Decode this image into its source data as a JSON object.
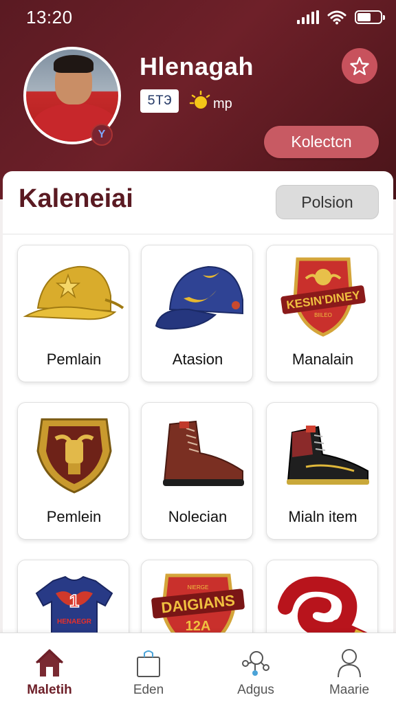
{
  "status_bar": {
    "time": "13:20",
    "icons": [
      "signal-icon",
      "wifi-icon",
      "battery-icon"
    ]
  },
  "profile": {
    "name": "Hlenagah",
    "level_chip": "5ΤЭ",
    "currency_label": "mp",
    "collection_button": "Kolectcn"
  },
  "section": {
    "title": "Kaleneiai",
    "filter_button": "Polsion"
  },
  "items": [
    {
      "label": "Pemlain",
      "icon": "gold-cap-icon"
    },
    {
      "label": "Atasion",
      "icon": "blue-cap-icon"
    },
    {
      "label": "Manalain",
      "icon": "red-shield-badge-icon"
    },
    {
      "label": "Pemlein",
      "icon": "gold-crest-icon"
    },
    {
      "label": "Nolecian",
      "icon": "brown-boot-icon"
    },
    {
      "label": "Mialn item",
      "icon": "black-boot-icon"
    },
    {
      "label": "",
      "icon": "blue-jersey-icon",
      "jersey_text": "HENAEGR"
    },
    {
      "label": "",
      "icon": "team-badge-icon",
      "badge_text": "DAIGIANS",
      "badge_sub": "12A",
      "badge_top": "NIERGE"
    },
    {
      "label": "",
      "icon": "red-scarf-icon"
    }
  ],
  "nav": [
    {
      "label": "Maletih",
      "icon": "home-icon",
      "active": true
    },
    {
      "label": "Eden",
      "icon": "bag-icon",
      "active": false
    },
    {
      "label": "Adgus",
      "icon": "network-icon",
      "active": false
    },
    {
      "label": "Maarie",
      "icon": "person-icon",
      "active": false
    }
  ],
  "colors": {
    "header": "#6e2029",
    "accent": "#c85a63",
    "title": "#5a1a22"
  }
}
